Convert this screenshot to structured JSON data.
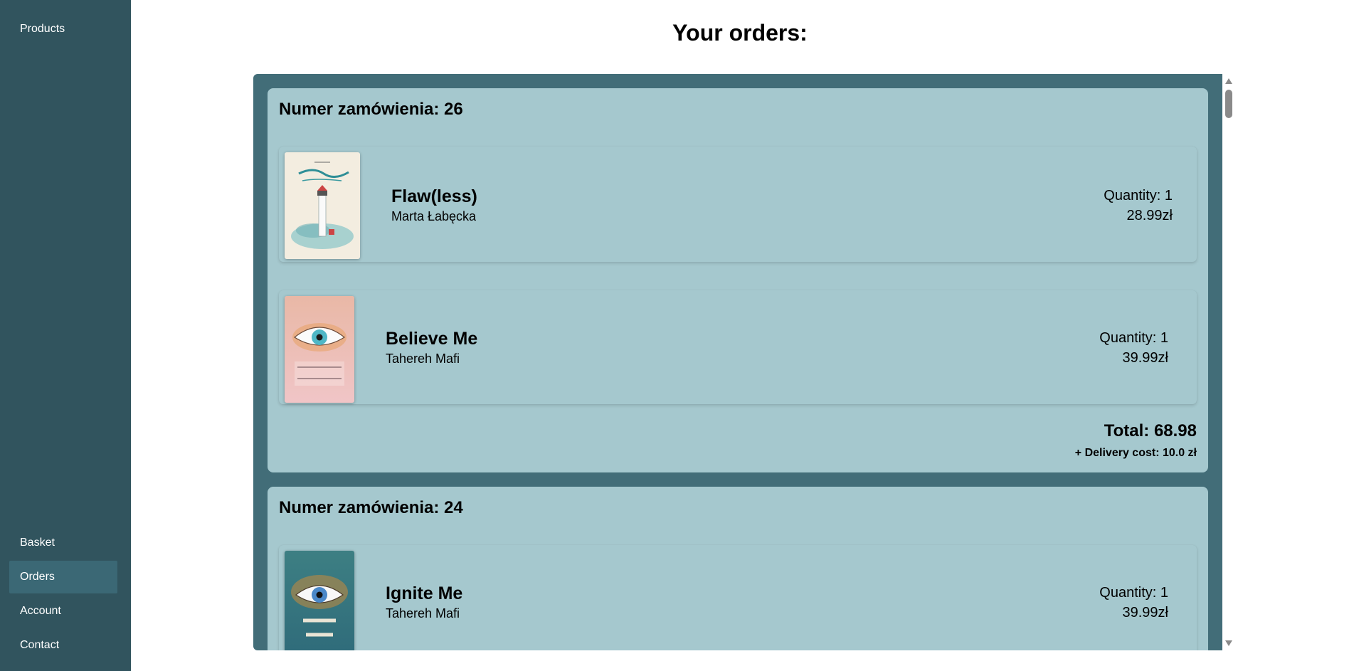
{
  "sidebar": {
    "top_items": [
      {
        "label": "Products"
      }
    ],
    "bottom_items": [
      {
        "label": "Basket"
      },
      {
        "label": "Orders",
        "active": true
      },
      {
        "label": "Account"
      },
      {
        "label": "Contact"
      }
    ]
  },
  "page": {
    "title": "Your orders:"
  },
  "orders": [
    {
      "heading": "Numer zamówienia: 26",
      "items": [
        {
          "title": "Flaw(less)",
          "author": "Marta Łabęcka",
          "quantity": "Quantity: 1",
          "price": "28.99zł",
          "cover_icon": "lighthouse-book-cover"
        },
        {
          "title": "Believe Me",
          "author": "Tahereh Mafi",
          "quantity": "Quantity: 1",
          "price": "39.99zł",
          "cover_icon": "eye-book-cover"
        }
      ],
      "total": "Total: 68.98",
      "delivery": "+ Delivery cost: 10.0 zł"
    },
    {
      "heading": "Numer zamówienia: 24",
      "items": [
        {
          "title": "Ignite Me",
          "author": "Tahereh Mafi",
          "quantity": "Quantity: 1",
          "price": "39.99zł",
          "cover_icon": "eye-book-cover"
        }
      ]
    }
  ],
  "colors": {
    "sidebar_bg": "#31545e",
    "sidebar_active": "#3b6875",
    "panel_bg": "#426d78",
    "card_bg": "#a5c8ce"
  }
}
